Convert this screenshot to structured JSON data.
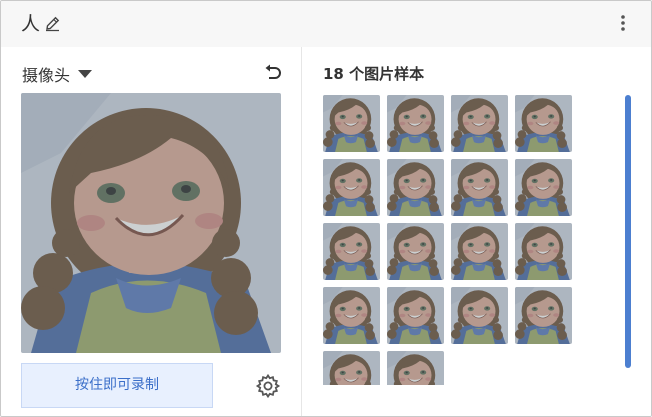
{
  "header": {
    "person_glyph": "人",
    "edit_icon": "pen-icon",
    "menu_icon": "more-vert-icon"
  },
  "camera": {
    "source_label": "摄像头",
    "record_button": "按住即可录制",
    "reset_icon": "undo-icon",
    "settings_icon": "gear-icon"
  },
  "samples": {
    "title": "18 个图片样本",
    "count": 18
  },
  "colors": {
    "accent": "#4c7fd0",
    "button_bg": "#e8f0fe",
    "button_text": "#3b6fc9",
    "header_bg": "#f7f7f7"
  }
}
